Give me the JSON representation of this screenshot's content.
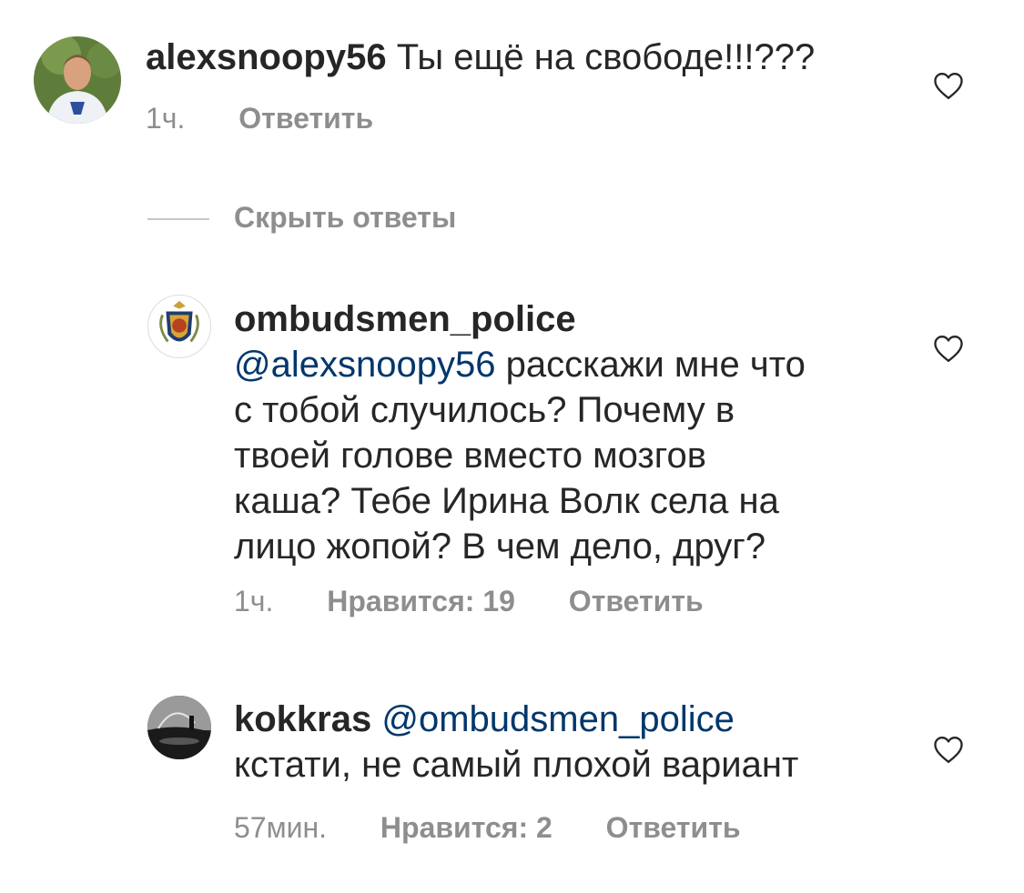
{
  "comments": [
    {
      "username": "alexsnoopy56",
      "text": "Ты ещё на свободе!!!???",
      "time": "1ч.",
      "reply_label": "Ответить",
      "avatar_icon": "user-photo-avatar",
      "liked": false
    },
    {
      "username": "ombudsmen_police",
      "mention": "@alexsnoopy56",
      "text_lines": [
        "расскажи мне что",
        "с тобой случилось? Почему в",
        "твоей голове вместо мозгов",
        "каша? Тебе Ирина Волк села на",
        "лицо жопой? В чем дело, друг?"
      ],
      "time": "1ч.",
      "likes_label": "Нравится: 19",
      "reply_label": "Ответить",
      "avatar_icon": "police-emblem-avatar",
      "liked": false
    },
    {
      "username": "kokkras",
      "mention": "@ombudsmen_police",
      "text": "кстати, не самый плохой вариант",
      "time": "57мин.",
      "likes_label": "Нравится: 2",
      "reply_label": "Ответить",
      "avatar_icon": "landscape-photo-avatar",
      "liked": false
    }
  ],
  "hide_replies_label": "Скрыть ответы",
  "colors": {
    "text": "#262626",
    "secondary": "#8e8e8e",
    "mention": "#00376b",
    "divider": "#c7c7c7"
  },
  "icons": {
    "like": "heart-outline-icon"
  }
}
